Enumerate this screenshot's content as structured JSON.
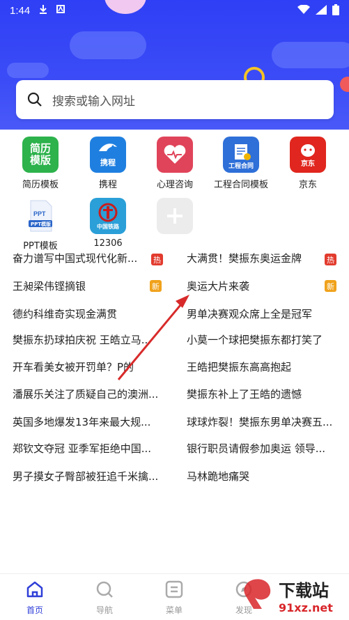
{
  "status_bar": {
    "time": "1:44"
  },
  "search": {
    "placeholder": "搜索或输入网址"
  },
  "apps": [
    {
      "label": "简历模板",
      "icon_text": "简历\n模版",
      "icon": "resume-template-icon"
    },
    {
      "label": "携程",
      "icon_text": "携程",
      "icon": "ctrip-icon"
    },
    {
      "label": "心理咨询",
      "icon_text": "",
      "icon": "psychology-heart-icon"
    },
    {
      "label": "工程合同模板",
      "icon_text": "工程合同",
      "icon": "contract-template-icon"
    },
    {
      "label": "京东",
      "icon_text": "京东",
      "icon": "jd-icon"
    },
    {
      "label": "PPT模板",
      "icon_text": "PPT模版",
      "icon": "ppt-template-icon"
    },
    {
      "label": "12306",
      "icon_text": "中国铁路",
      "icon": "railway-12306-icon"
    },
    {
      "label": "",
      "icon_text": "",
      "icon": "add-app-icon"
    }
  ],
  "news": [
    {
      "text": "奋力谱写中国式现代化新...",
      "badge": "热"
    },
    {
      "text": "大满贯！樊振东奥运金牌",
      "badge": "热"
    },
    {
      "text": "王昶梁伟铿摘银",
      "badge": "新"
    },
    {
      "text": "奥运大片来袭",
      "badge": "新"
    },
    {
      "text": "德约科维奇实现金满贯",
      "badge": ""
    },
    {
      "text": "男单决赛观众席上全是冠军",
      "badge": ""
    },
    {
      "text": "樊振东扔球拍庆祝 王皓立马...",
      "badge": ""
    },
    {
      "text": "小莫一个球把樊振东都打笑了",
      "badge": ""
    },
    {
      "text": "开车看美女被开罚单？P的",
      "badge": ""
    },
    {
      "text": "王皓把樊振东高高抱起",
      "badge": ""
    },
    {
      "text": "潘展乐关注了质疑自己的澳洲...",
      "badge": ""
    },
    {
      "text": "樊振东补上了王皓的遗憾",
      "badge": ""
    },
    {
      "text": "英国多地爆发13年来最大规...",
      "badge": ""
    },
    {
      "text": "球球炸裂！樊振东男单决赛五...",
      "badge": ""
    },
    {
      "text": "郑钦文夺冠 亚季军拒绝中国...",
      "badge": ""
    },
    {
      "text": "银行职员请假参加奥运 领导...",
      "badge": ""
    },
    {
      "text": "男子摸女子臀部被狂追千米擒...",
      "badge": ""
    },
    {
      "text": "马林跪地痛哭",
      "badge": ""
    }
  ],
  "bottom_nav": [
    {
      "label": "首页",
      "icon": "home-icon",
      "active": true
    },
    {
      "label": "导航",
      "icon": "compass-icon",
      "active": false
    },
    {
      "label": "菜单",
      "icon": "menu-icon",
      "active": false
    },
    {
      "label": "发现",
      "icon": "discover-icon",
      "active": false
    }
  ],
  "watermark": {
    "text": "下载站",
    "url": "91xz.net"
  },
  "colors": {
    "hero": "#2f3ff5",
    "active": "#2f3fd8",
    "hot": "#e23b2e",
    "new": "#f0a21b",
    "arrow": "#d82a2a"
  }
}
